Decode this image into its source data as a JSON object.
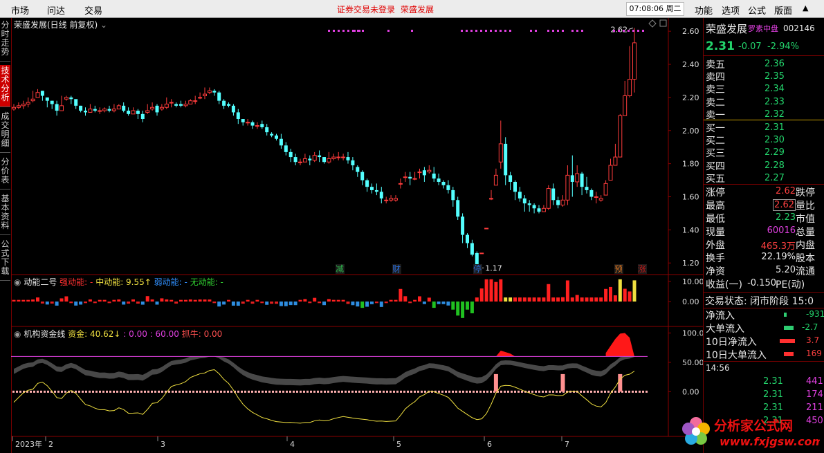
{
  "topbar": {
    "menu_left": [
      "市场",
      "问达",
      "交易"
    ],
    "notice": [
      "证券交易未登录",
      "荣盛发展"
    ],
    "clock": "07:08:06 周二",
    "menu_right": [
      "功能",
      "选项",
      "公式",
      "版面"
    ],
    "up_arrow": "▲"
  },
  "left_tabs": [
    {
      "label": "分时走势",
      "active": false
    },
    {
      "label": "技术分析",
      "active": true
    },
    {
      "label": "成交明细",
      "active": false
    },
    {
      "label": "分价表",
      "active": false
    },
    {
      "label": "基本资料",
      "active": false
    },
    {
      "label": "公式下载",
      "active": false
    }
  ],
  "main_chart": {
    "title": "荣盛发展(日线 前复权)",
    "y_ticks": [
      "2.60",
      "2.40",
      "2.20",
      "2.00",
      "1.80",
      "1.60",
      "1.40",
      "1.20"
    ],
    "high_label": "2.62",
    "low_label": "1.17",
    "x_labels": [
      "2023年",
      "2",
      "3",
      "4",
      "5",
      "6",
      "7"
    ],
    "markers": [
      {
        "text": "减",
        "color": "#2db54b"
      },
      {
        "text": "财",
        "color": "#2b6bd6"
      },
      {
        "text": "停",
        "color": "#2b6bd6"
      },
      {
        "text": "预",
        "color": "#d07020"
      },
      {
        "text": "涨",
        "color": "#c01818"
      }
    ]
  },
  "chart_data": {
    "type": "candlestick",
    "title": "荣盛发展(日线 前复权)",
    "ylim": [
      1.13,
      2.68
    ],
    "x_ticks": [
      "2023年",
      "2",
      "3",
      "4",
      "5",
      "6",
      "7"
    ],
    "close": [
      2.14,
      2.15,
      2.16,
      2.17,
      2.19,
      2.23,
      2.21,
      2.18,
      2.16,
      2.12,
      2.15,
      2.2,
      2.19,
      2.15,
      2.12,
      2.11,
      2.13,
      2.12,
      2.12,
      2.13,
      2.12,
      2.13,
      2.15,
      2.12,
      2.1,
      2.12,
      2.1,
      2.07,
      2.12,
      2.14,
      2.11,
      2.14,
      2.16,
      2.17,
      2.15,
      2.15,
      2.16,
      2.18,
      2.18,
      2.2,
      2.22,
      2.24,
      2.23,
      2.18,
      2.15,
      2.15,
      2.11,
      2.07,
      2.05,
      2.05,
      2.03,
      2.03,
      2.02,
      1.99,
      1.97,
      1.95,
      1.91,
      1.87,
      1.84,
      1.81,
      1.81,
      1.83,
      1.82,
      1.85,
      1.84,
      1.81,
      1.83,
      1.84,
      1.84,
      1.84,
      1.82,
      1.79,
      1.75,
      1.7,
      1.66,
      1.64,
      1.63,
      1.59,
      1.58,
      1.59,
      1.59,
      1.68,
      1.72,
      1.71,
      1.71,
      1.75,
      1.73,
      1.76,
      1.71,
      1.69,
      1.67,
      1.64,
      1.58,
      1.48,
      1.37,
      1.32,
      1.25,
      1.19,
      1.26,
      1.41,
      1.59,
      1.73,
      1.92,
      1.73,
      1.69,
      1.63,
      1.59,
      1.56,
      1.55,
      1.53,
      1.51,
      1.53,
      1.65,
      1.58,
      1.55,
      1.58,
      1.73,
      1.69,
      1.74,
      1.66,
      1.64,
      1.6,
      1.6,
      1.59,
      1.68,
      1.79,
      1.84,
      2.09,
      2.21,
      2.31,
      2.53
    ],
    "low": [
      2.12,
      2.13,
      2.13,
      2.14,
      2.17,
      2.21,
      2.18,
      2.14,
      2.13,
      2.09,
      2.12,
      2.18,
      2.16,
      2.13,
      2.11,
      2.09,
      2.11,
      2.11,
      2.1,
      2.11,
      2.11,
      2.11,
      2.13,
      2.11,
      2.09,
      2.1,
      2.07,
      2.05,
      2.1,
      2.12,
      2.09,
      2.12,
      2.13,
      2.14,
      2.14,
      2.14,
      2.14,
      2.16,
      2.16,
      2.19,
      2.19,
      2.22,
      2.21,
      2.16,
      2.13,
      2.14,
      2.09,
      2.04,
      2.03,
      2.03,
      2.01,
      2.01,
      2.01,
      1.97,
      1.96,
      1.94,
      1.89,
      1.85,
      1.81,
      1.79,
      1.79,
      1.81,
      1.79,
      1.81,
      1.81,
      1.8,
      1.8,
      1.82,
      1.82,
      1.82,
      1.8,
      1.76,
      1.72,
      1.67,
      1.63,
      1.62,
      1.61,
      1.56,
      1.56,
      1.57,
      1.57,
      1.65,
      1.69,
      1.67,
      1.7,
      1.71,
      1.69,
      1.74,
      1.69,
      1.67,
      1.65,
      1.62,
      1.54,
      1.46,
      1.32,
      1.29,
      1.24,
      1.17,
      1.26,
      1.41,
      1.58,
      1.68,
      1.77,
      1.67,
      1.64,
      1.58,
      1.57,
      1.51,
      1.51,
      1.5,
      1.5,
      1.51,
      1.52,
      1.55,
      1.53,
      1.54,
      1.55,
      1.6,
      1.66,
      1.61,
      1.62,
      1.58,
      1.56,
      1.57,
      1.61,
      1.7,
      1.79,
      1.84,
      2.09,
      2.2,
      2.23
    ],
    "high": [
      2.16,
      2.17,
      2.18,
      2.2,
      2.24,
      2.25,
      2.24,
      2.2,
      2.18,
      2.18,
      2.21,
      2.21,
      2.21,
      2.18,
      2.15,
      2.14,
      2.16,
      2.15,
      2.14,
      2.14,
      2.15,
      2.16,
      2.16,
      2.17,
      2.14,
      2.14,
      2.13,
      2.12,
      2.16,
      2.17,
      2.16,
      2.16,
      2.2,
      2.19,
      2.17,
      2.18,
      2.18,
      2.19,
      2.21,
      2.23,
      2.26,
      2.26,
      2.25,
      2.24,
      2.19,
      2.17,
      2.16,
      2.13,
      2.07,
      2.07,
      2.06,
      2.05,
      2.06,
      2.04,
      1.99,
      1.98,
      1.98,
      1.93,
      1.89,
      1.86,
      1.83,
      1.86,
      1.85,
      1.87,
      1.88,
      1.84,
      1.87,
      1.86,
      1.87,
      1.86,
      1.87,
      1.84,
      1.79,
      1.76,
      1.71,
      1.68,
      1.68,
      1.66,
      1.6,
      1.61,
      1.61,
      1.71,
      1.75,
      1.75,
      1.75,
      1.77,
      1.78,
      1.79,
      1.78,
      1.74,
      1.7,
      1.7,
      1.66,
      1.6,
      1.5,
      1.38,
      1.34,
      1.27,
      1.26,
      1.41,
      1.64,
      1.77,
      2.06,
      1.96,
      1.75,
      1.7,
      1.66,
      1.61,
      1.58,
      1.56,
      1.55,
      1.55,
      1.67,
      1.68,
      1.6,
      1.61,
      1.79,
      1.85,
      1.79,
      1.75,
      1.72,
      1.65,
      1.63,
      1.61,
      1.7,
      1.83,
      1.92,
      2.1,
      2.3,
      2.51,
      2.62
    ],
    "open": [
      2.13,
      2.14,
      2.15,
      2.16,
      2.18,
      2.2,
      2.24,
      2.2,
      2.18,
      2.16,
      2.12,
      2.19,
      2.2,
      2.19,
      2.15,
      2.12,
      2.11,
      2.13,
      2.12,
      2.12,
      2.13,
      2.12,
      2.13,
      2.15,
      2.12,
      2.1,
      2.12,
      2.1,
      2.11,
      2.13,
      2.15,
      2.13,
      2.14,
      2.17,
      2.16,
      2.16,
      2.15,
      2.16,
      2.18,
      2.2,
      2.21,
      2.23,
      2.24,
      2.23,
      2.18,
      2.16,
      2.15,
      2.11,
      2.07,
      2.05,
      2.05,
      2.03,
      2.04,
      2.02,
      1.98,
      1.97,
      1.95,
      1.91,
      1.87,
      1.84,
      1.81,
      1.81,
      1.83,
      1.82,
      1.85,
      1.84,
      1.81,
      1.83,
      1.84,
      1.84,
      1.84,
      1.82,
      1.78,
      1.75,
      1.7,
      1.66,
      1.64,
      1.63,
      1.58,
      1.58,
      1.58,
      1.68,
      1.72,
      1.72,
      1.71,
      1.75,
      1.76,
      1.75,
      1.74,
      1.71,
      1.69,
      1.67,
      1.64,
      1.58,
      1.48,
      1.37,
      1.32,
      1.26,
      1.26,
      1.41,
      1.59,
      1.67,
      1.81,
      1.92,
      1.73,
      1.69,
      1.63,
      1.59,
      1.56,
      1.55,
      1.53,
      1.51,
      1.53,
      1.65,
      1.58,
      1.55,
      1.58,
      1.73,
      1.69,
      1.74,
      1.66,
      1.64,
      1.6,
      1.58,
      1.61,
      1.7,
      1.79,
      1.84,
      2.09,
      2.21,
      2.31
    ],
    "volume_ylim": [
      -12,
      13
    ],
    "volume_ticks": [
      "10.00",
      "0.00"
    ],
    "fund_ylim": [
      -75,
      110
    ],
    "fund_ticks": [
      "100.00",
      "50.00",
      "0.00"
    ]
  },
  "indicator1": {
    "title": "动能二号",
    "strong": "强动能: -",
    "mid": "中动能: 9.55↑",
    "weak": "弱动能: -",
    "none": "无动能: -"
  },
  "indicator2": {
    "title": "机构资金线",
    "fund": "资金: 40.62↓",
    "v1": ": 0.00",
    "v2": ": 60.00",
    "bull": "抓牛: 0.00"
  },
  "quote": {
    "name": "荣盛发展",
    "tag": "罗素中盘",
    "code": "002146",
    "price": "2.31",
    "change": "-0.07",
    "change_pct": "-2.94%",
    "asks": [
      [
        "卖五",
        "2.36"
      ],
      [
        "卖四",
        "2.35"
      ],
      [
        "卖三",
        "2.34"
      ],
      [
        "卖二",
        "2.33"
      ],
      [
        "卖一",
        "2.32"
      ]
    ],
    "bids": [
      [
        "买一",
        "2.31"
      ],
      [
        "买二",
        "2.30"
      ],
      [
        "买三",
        "2.29"
      ],
      [
        "买四",
        "2.28"
      ],
      [
        "买五",
        "2.27"
      ]
    ],
    "stats": [
      [
        "涨停",
        "2.62",
        "跌停"
      ],
      [
        "最高",
        "2.62",
        "量比"
      ],
      [
        "最低",
        "2.23",
        "市值"
      ],
      [
        "现量",
        "60016",
        "总量"
      ],
      [
        "外盘",
        "465.3万",
        "内盘"
      ],
      [
        "换手",
        "22.19%",
        "股本"
      ],
      [
        "净资",
        "5.20",
        "流通"
      ],
      [
        "收益(一)",
        "-0.150",
        "PE(动)"
      ]
    ],
    "status": "交易状态: 闭市阶段 15:0",
    "flows": [
      [
        "净流入",
        "-931"
      ],
      [
        "大单流入",
        "-2.7"
      ],
      [
        "10日净流入",
        "3.7"
      ],
      [
        "10日大单流入",
        "169"
      ]
    ],
    "tick_time": "14:56",
    "ticks": [
      [
        "2.31",
        "441"
      ],
      [
        "2.31",
        "174"
      ],
      [
        "2.31",
        "211"
      ],
      [
        "2.31",
        "450"
      ]
    ]
  },
  "logo": {
    "text": "分析家公式网",
    "url": "www.fxjgsw.com"
  }
}
